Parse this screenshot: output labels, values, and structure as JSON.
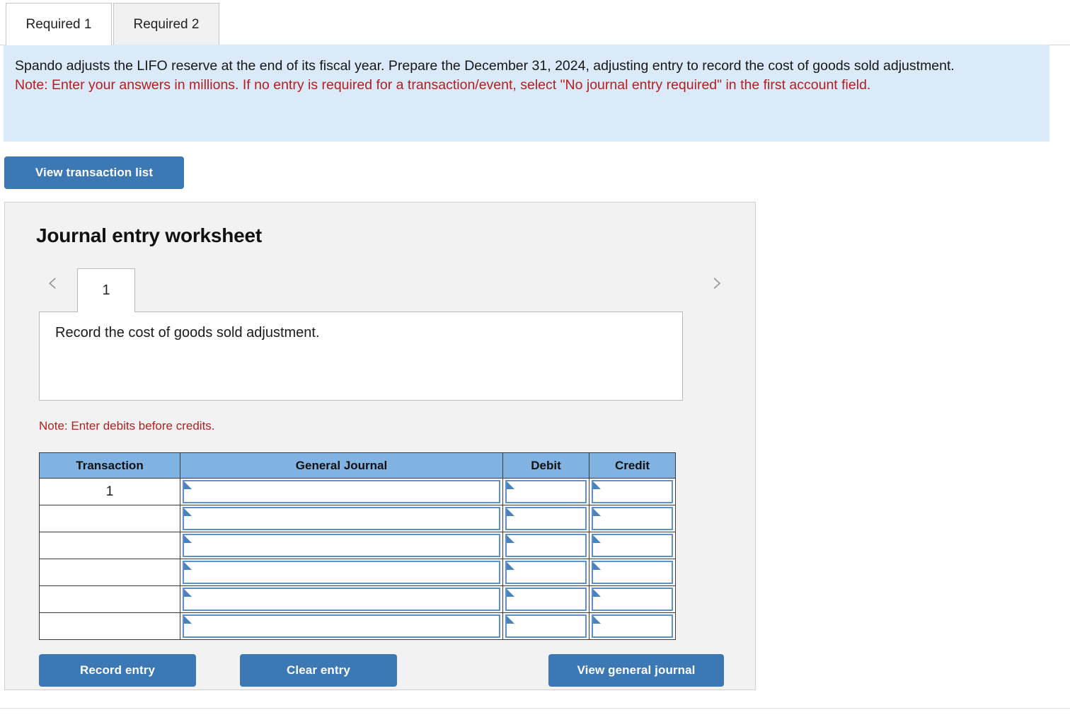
{
  "tabs": [
    {
      "label": "Required 1",
      "active": true
    },
    {
      "label": "Required 2",
      "active": false
    }
  ],
  "instructions": {
    "body": "Spando adjusts the LIFO reserve at the end of its fiscal year. Prepare the December 31, 2024, adjusting entry to record the cost of goods sold adjustment.",
    "note": "Note: Enter your answers in millions. If no entry is required for a transaction/event, select \"No journal entry required\" in the first account field.",
    "body_color": "#171717",
    "note_color": "#b32020",
    "background_color": "#daeaf8"
  },
  "toolbar": {
    "view_transaction_list_label": "View transaction list"
  },
  "worksheet": {
    "title": "Journal entry worksheet",
    "prev_arrow": "‹",
    "next_arrow": "›",
    "page_tab_label": "1",
    "description": "Record the cost of goods sold adjustment.",
    "debit_note": "Note: Enter debits before credits.",
    "table": {
      "headers": [
        "Transaction",
        "General Journal",
        "Debit",
        "Credit"
      ],
      "header_color": "#80b2e2",
      "rows": [
        {
          "transaction": "1",
          "general_journal": "",
          "debit": "",
          "credit": ""
        },
        {
          "transaction": "",
          "general_journal": "",
          "debit": "",
          "credit": ""
        },
        {
          "transaction": "",
          "general_journal": "",
          "debit": "",
          "credit": ""
        },
        {
          "transaction": "",
          "general_journal": "",
          "debit": "",
          "credit": ""
        },
        {
          "transaction": "",
          "general_journal": "",
          "debit": "",
          "credit": ""
        },
        {
          "transaction": "",
          "general_journal": "",
          "debit": "",
          "credit": ""
        }
      ]
    },
    "buttons": {
      "record_entry_label": "Record entry",
      "clear_entry_label": "Clear entry",
      "view_general_journal_label": "View general journal"
    }
  },
  "colors": {
    "button_blue": "#3c78b4",
    "panel_gray": "#f2f2f2",
    "field_border_blue": "#5b91c8"
  }
}
